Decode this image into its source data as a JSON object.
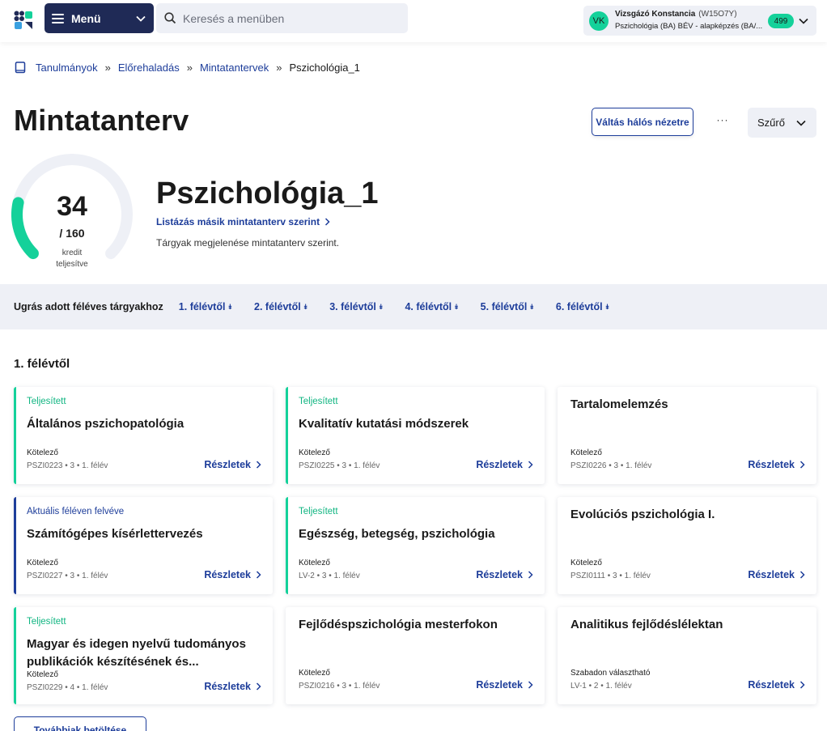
{
  "header": {
    "menu_label": "Menü",
    "search_placeholder": "Keresés a menüben",
    "user": {
      "initials": "VK",
      "name": "Vizsgázó Konstancia",
      "code": "(W15O7Y)",
      "program": "Pszichológia (BA) BÉV - alapképzés (BA/...",
      "badge": "499"
    }
  },
  "breadcrumb": {
    "items": [
      "Tanulmányok",
      "Előrehaladás",
      "Mintatantervek"
    ],
    "current": "Pszichológia_1",
    "separator": "»"
  },
  "page": {
    "title": "Mintatanterv",
    "grid_view_button": "Váltás hálós nézetre",
    "more_label": "···",
    "filter_label": "Szűrő"
  },
  "progress": {
    "value": "34",
    "total": "/ 160",
    "caption1": "kredit",
    "caption2": "teljesítve",
    "fraction": 0.2125
  },
  "plan": {
    "title": "Pszichológia_1",
    "link": "Listázás másik mintatanterv szerint",
    "description": "Tárgyak megjelenése mintatanterv szerint."
  },
  "jump": {
    "label": "Ugrás adott féléves tárgyakhoz",
    "links": [
      "1. félévtől",
      "2. félévtől",
      "3. félévtől",
      "4. félévtől",
      "5. félévtől",
      "6. félévtől"
    ]
  },
  "section": {
    "title": "1. félévtől"
  },
  "cards": [
    {
      "status": "Teljesített",
      "title": "Általános pszichopatológia",
      "type": "Kötelező",
      "meta": "PSZI0223 • 3 • 1. félév",
      "details": "Részletek"
    },
    {
      "status": "Teljesített",
      "title": "Kvalitatív kutatási módszerek",
      "type": "Kötelező",
      "meta": "PSZI0225 • 3 • 1. félév",
      "details": "Részletek"
    },
    {
      "status": "",
      "title": "Tartalomelemzés",
      "type": "Kötelező",
      "meta": "PSZI0226 • 3 • 1. félév",
      "details": "Részletek"
    },
    {
      "status": "Aktuális féléven felvéve",
      "title": "Számítógépes kísérlettervezés",
      "type": "Kötelező",
      "meta": "PSZI0227 • 3 • 1. félév",
      "details": "Részletek"
    },
    {
      "status": "Teljesített",
      "title": "Egészség, betegség, pszichológia",
      "type": "Kötelező",
      "meta": "LV-2 • 3 • 1. félév",
      "details": "Részletek"
    },
    {
      "status": "",
      "title": "Evolúciós pszichológia I.",
      "type": "Kötelező",
      "meta": "PSZI0111 • 3 • 1. félév",
      "details": "Részletek"
    },
    {
      "status": "Teljesített",
      "title": "Magyar és idegen nyelvű tudományos publikációk készítésének és...",
      "type": "Kötelező",
      "meta": "PSZI0229 • 4 • 1. félév",
      "details": "Részletek"
    },
    {
      "status": "",
      "title": "Fejlődéspszichológia mesterfokon",
      "type": "Kötelező",
      "meta": "PSZI0216 • 3 • 1. félév",
      "details": "Részletek"
    },
    {
      "status": "",
      "title": "Analitikus fejlődéslélektan",
      "type": "Szabadon választható",
      "meta": "LV-1 • 2 • 1. félév",
      "details": "Részletek"
    }
  ],
  "load_more": "Továbbiak betöltése",
  "colors": {
    "navy": "#1f2a56",
    "link_blue": "#1d3d9a",
    "green": "#14d19a",
    "panel_gray": "#eef0f6"
  }
}
